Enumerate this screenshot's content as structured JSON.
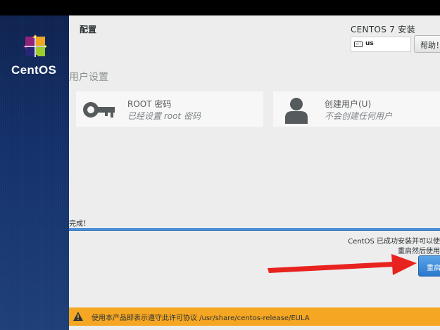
{
  "sidebar": {
    "brand": "CentOS"
  },
  "header": {
    "title": "配置",
    "install_title": "CENTOS 7 安装",
    "keyboard_layout": "us",
    "help_label": "帮助！"
  },
  "user_settings": {
    "heading": "用户设置",
    "root": {
      "name": "ROOT 密码",
      "status": "已经设置 root 密码"
    },
    "user": {
      "name": "创建用户(U)",
      "status": "不会创建任何用户"
    }
  },
  "progress": {
    "done_text": "完成！",
    "fraction": 1.0,
    "message_line1": "CentOS 已成功安装并可以使",
    "message_line2": "重启然后使用",
    "reboot_label": "重启"
  },
  "license_bar": {
    "text": "使用本产品即表示遵守此许可协议 /usr/share/centos-release/EULA"
  },
  "colors": {
    "sidebar": "#14306a",
    "accent": "#4a90d9",
    "warning": "#f5a623",
    "annotation_arrow": "#e8231f"
  }
}
